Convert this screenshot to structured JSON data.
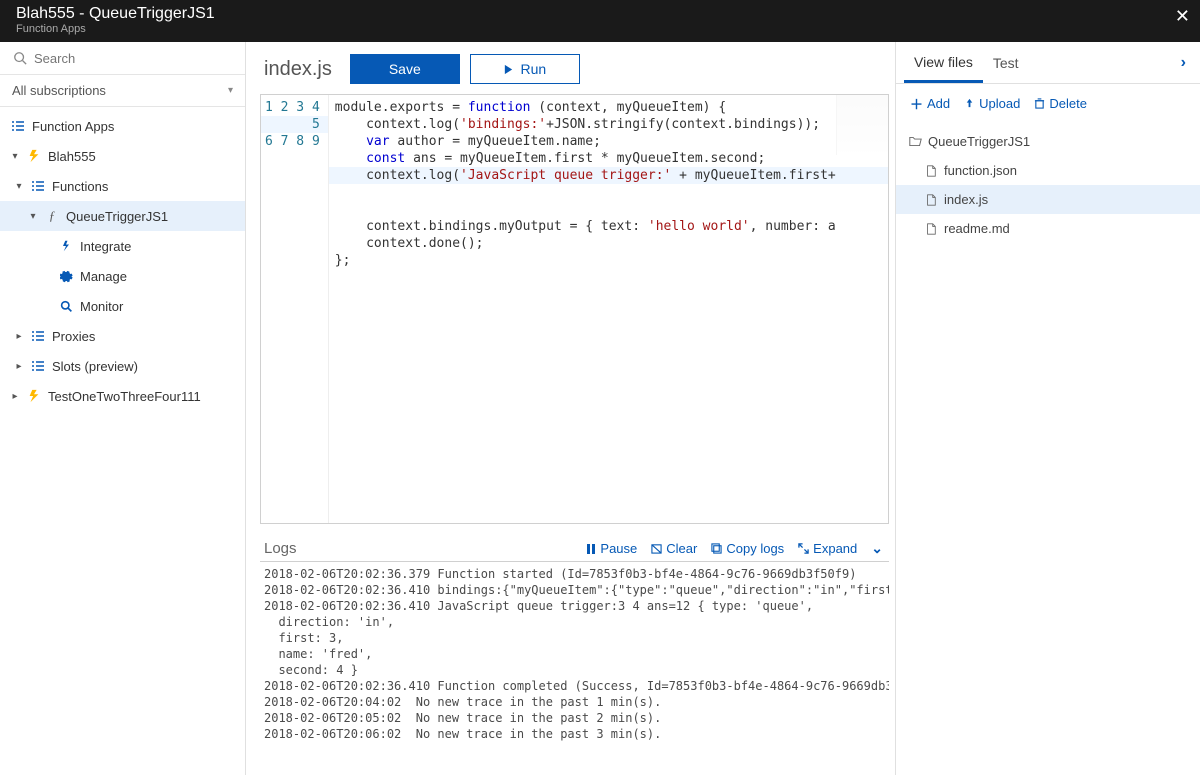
{
  "header": {
    "title": "Blah555 - QueueTriggerJS1",
    "subtitle": "Function Apps"
  },
  "search": {
    "placeholder": "Search"
  },
  "subscriptions_label": "All subscriptions",
  "tree": {
    "function_apps_label": "Function Apps",
    "app1": "Blah555",
    "functions_label": "Functions",
    "fn1": "QueueTriggerJS1",
    "integrate": "Integrate",
    "manage": "Manage",
    "monitor": "Monitor",
    "proxies": "Proxies",
    "slots": "Slots (preview)",
    "app2": "TestOneTwoThreeFour111"
  },
  "toolbar": {
    "filename": "index.js",
    "save": "Save",
    "run": "Run"
  },
  "code": {
    "lines": [
      1,
      2,
      3,
      4,
      5,
      6,
      7,
      8,
      9
    ],
    "html": "module.exports = <span class='kw'>function</span> (context, myQueueItem) {\n    context.log(<span class='str'>'bindings:'</span>+JSON.stringify(context.bindings));\n    <span class='kw'>var</span> author = myQueueItem.name;\n    <span class='kw'>const</span> ans = myQueueItem.first * myQueueItem.second;\n<span class='cur-ln'>    context.log(<span class='str'>'JavaScript queue trigger:'</span> + myQueueItem.first+</span>\n\n    context.bindings.myOutput = { text: <span class='str'>'hello world'</span>, number: a\n    context.done();\n};"
  },
  "logs": {
    "title": "Logs",
    "pause": "Pause",
    "clear": "Clear",
    "copy": "Copy logs",
    "expand": "Expand",
    "body": "2018-02-06T20:02:36.379 Function started (Id=7853f0b3-bf4e-4864-9c76-9669db3f50f9)\n2018-02-06T20:02:36.410 bindings:{\"myQueueItem\":{\"type\":\"queue\",\"direction\":\"in\",\"first\n2018-02-06T20:02:36.410 JavaScript queue trigger:3 4 ans=12 { type: 'queue',\n  direction: 'in',\n  first: 3,\n  name: 'fred',\n  second: 4 }\n2018-02-06T20:02:36.410 Function completed (Success, Id=7853f0b3-bf4e-4864-9c76-9669db3\n2018-02-06T20:04:02  No new trace in the past 1 min(s).\n2018-02-06T20:05:02  No new trace in the past 2 min(s).\n2018-02-06T20:06:02  No new trace in the past 3 min(s)."
  },
  "right": {
    "tabs": {
      "view_files": "View files",
      "test": "Test"
    },
    "actions": {
      "add": "Add",
      "upload": "Upload",
      "delete": "Delete"
    },
    "folder": "QueueTriggerJS1",
    "files": {
      "f1": "function.json",
      "f2": "index.js",
      "f3": "readme.md"
    }
  }
}
